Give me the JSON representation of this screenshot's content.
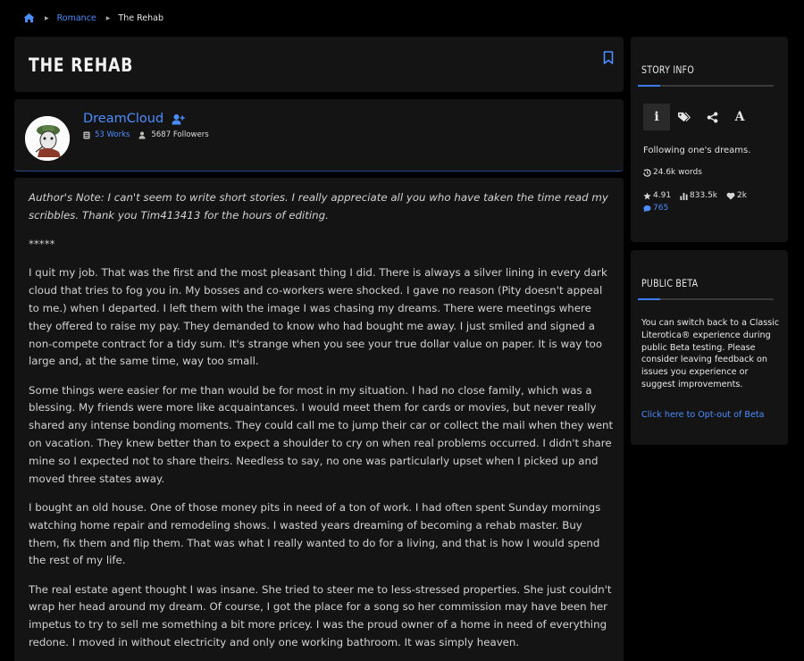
{
  "breadcrumb": {
    "category": "Romance",
    "current": "The Rehab"
  },
  "story": {
    "title": "THE REHAB",
    "paragraphs": [
      "Author's Note: I can't seem to write short stories. I really appreciate all you who have taken the time read my scribbles. Thank you Tim413413 for the hours of editing.",
      "*****",
      "I quit my job. That was the first and the most pleasant thing I did. There is always a silver lining in every dark cloud that tries to fog you in. My bosses and co-workers were shocked. I gave no reason (Pity doesn't appeal to me.) when I departed. I left them with the image I was chasing my dreams. There were meetings where they offered to raise my pay. They demanded to know who had bought me away. I just smiled and signed a non-compete contract for a tidy sum. It's strange when you see your true dollar value on paper. It is way too large and, at the same time, way too small.",
      "Some things were easier for me than would be for most in my situation. I had no close family, which was a blessing. My friends were more like acquaintances. I would meet them for cards or movies, but never really shared any intense bonding moments. They could call me to jump their car or collect the mail when they went on vacation. They knew better than to expect a shoulder to cry on when real problems occurred. I didn't share mine so I expected not to share theirs. Needless to say, no one was particularly upset when I picked up and moved three states away.",
      "I bought an old house. One of those money pits in need of a ton of work. I had often spent Sunday mornings watching home repair and remodeling shows. I wasted years dreaming of becoming a rehab master. Buy them, fix them and flip them. That was what I really wanted to do for a living, and that is how I would spend the rest of my life.",
      "The real estate agent thought I was insane. She tried to steer me to less-stressed properties. She just couldn't wrap her head around my dream. Of course, I got the place for a song so her commission may have been her impetus to try to sell me something a bit more pricey. I was the proud owner of a home in need of everything redone. I moved in without electricity and only one working bathroom. It was simply heaven."
    ]
  },
  "author": {
    "name": "DreamCloud",
    "works": "53 Works",
    "followers": "5687 Followers"
  },
  "story_info": {
    "heading": "STORY INFO",
    "tabs": [
      {
        "name": "info",
        "glyph": "i"
      },
      {
        "name": "tags"
      },
      {
        "name": "share"
      },
      {
        "name": "font",
        "glyph": "A"
      }
    ],
    "description": "Following one's dreams.",
    "words": "24.6k words",
    "rating": "4.91",
    "views": "833.5k",
    "favorites": "2k",
    "comments": "765"
  },
  "public_beta": {
    "heading": "PUBLIC BETA",
    "text": "You can switch back to a Classic Literotica® experience during public Beta testing. Please consider leaving feedback on issues you experience or suggest improvements.",
    "link": "Click here to Opt-out of Beta"
  },
  "colors": {
    "accent": "#4c8dff",
    "panel": "#141414",
    "background": "#000000"
  }
}
